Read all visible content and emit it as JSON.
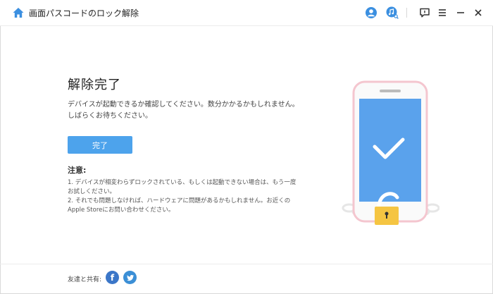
{
  "app": {
    "title": "画面パスコードのロック解除"
  },
  "main": {
    "heading": "解除完了",
    "description": "デバイスが起動できるか確認してください。数分かかるかもしれません。しばらくお待ちください。",
    "done_button": "完了",
    "notice_title": "注意:",
    "notices": [
      "1. デバイスが相変わらずロックされている、もしくは起動できない場合は、もう一度お試しください。",
      "2. それでも問題しなければ、ハードウェアに問題があるかもしれません。お近くのApple Storeにお問い合わせください。"
    ]
  },
  "footer": {
    "share_label": "友達と共有:"
  },
  "icons": {
    "home": "home-icon",
    "account": "user-icon",
    "music": "music-search-icon",
    "feedback": "chat-icon",
    "menu": "menu-icon",
    "minimize": "minimize-icon",
    "close": "close-icon",
    "facebook": "facebook-icon",
    "twitter": "twitter-icon"
  },
  "colors": {
    "accent": "#4da3ec",
    "icon_blue": "#3b8fe0",
    "phone_screen": "#5aa2ec",
    "lock": "#f5c542"
  }
}
